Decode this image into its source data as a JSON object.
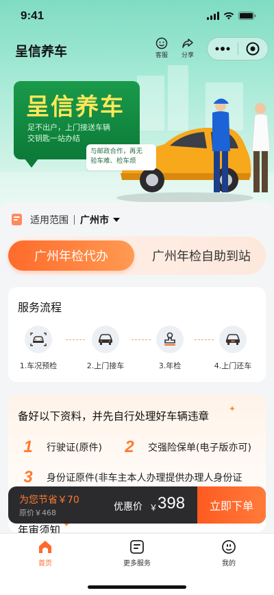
{
  "status_bar": {
    "time": "9:41"
  },
  "header": {
    "app_title": "呈信养车",
    "actions": [
      {
        "label": "客服",
        "icon": "customer-service-icon"
      },
      {
        "label": "分享",
        "icon": "share-icon"
      }
    ]
  },
  "banner": {
    "title": "呈信养车",
    "subtitle_line1": "足不出户，上门接送车辆",
    "subtitle_line2": "交钥匙一站办结",
    "partner_line1": "与邮政合作，再无",
    "partner_line2": "验车难、检车烦"
  },
  "scope": {
    "label": "适用范围",
    "city": "广州市"
  },
  "tabs": [
    {
      "label": "广州年检代办",
      "active": true
    },
    {
      "label": "广州年检自助到站",
      "active": false
    }
  ],
  "process": {
    "title": "服务流程",
    "steps": [
      {
        "label": "1.车况预检",
        "icon": "car-inspect-icon"
      },
      {
        "label": "2.上门接车",
        "icon": "car-pickup-icon"
      },
      {
        "label": "3.年检",
        "icon": "stamp-icon"
      },
      {
        "label": "4.上门还车",
        "icon": "car-return-icon"
      }
    ]
  },
  "documents": {
    "title": "备好以下资料，并先自行处理好车辆违章",
    "items": [
      {
        "num": "1",
        "text": "行驶证(原件)"
      },
      {
        "num": "2",
        "text": "交强险保单(电子版亦可)"
      },
      {
        "num": "3",
        "text": "身份证原件(非车主本人办理提供办理人身份证"
      }
    ]
  },
  "annual_notice": {
    "title": "年审须知"
  },
  "order_bar": {
    "savings": "为您节省￥70",
    "original_price": "原价￥468",
    "price_label": "优惠价",
    "currency": "￥",
    "price": "398",
    "button": "立即下单"
  },
  "tab_bar": [
    {
      "label": "首页",
      "icon": "home-icon",
      "active": true
    },
    {
      "label": "更多服务",
      "icon": "more-services-icon",
      "active": false
    },
    {
      "label": "我的",
      "icon": "profile-icon",
      "active": false
    }
  ],
  "colors": {
    "accent": "#ff6a2b",
    "banner_green": "#0c7a38",
    "banner_yellow": "#ffe75a"
  }
}
